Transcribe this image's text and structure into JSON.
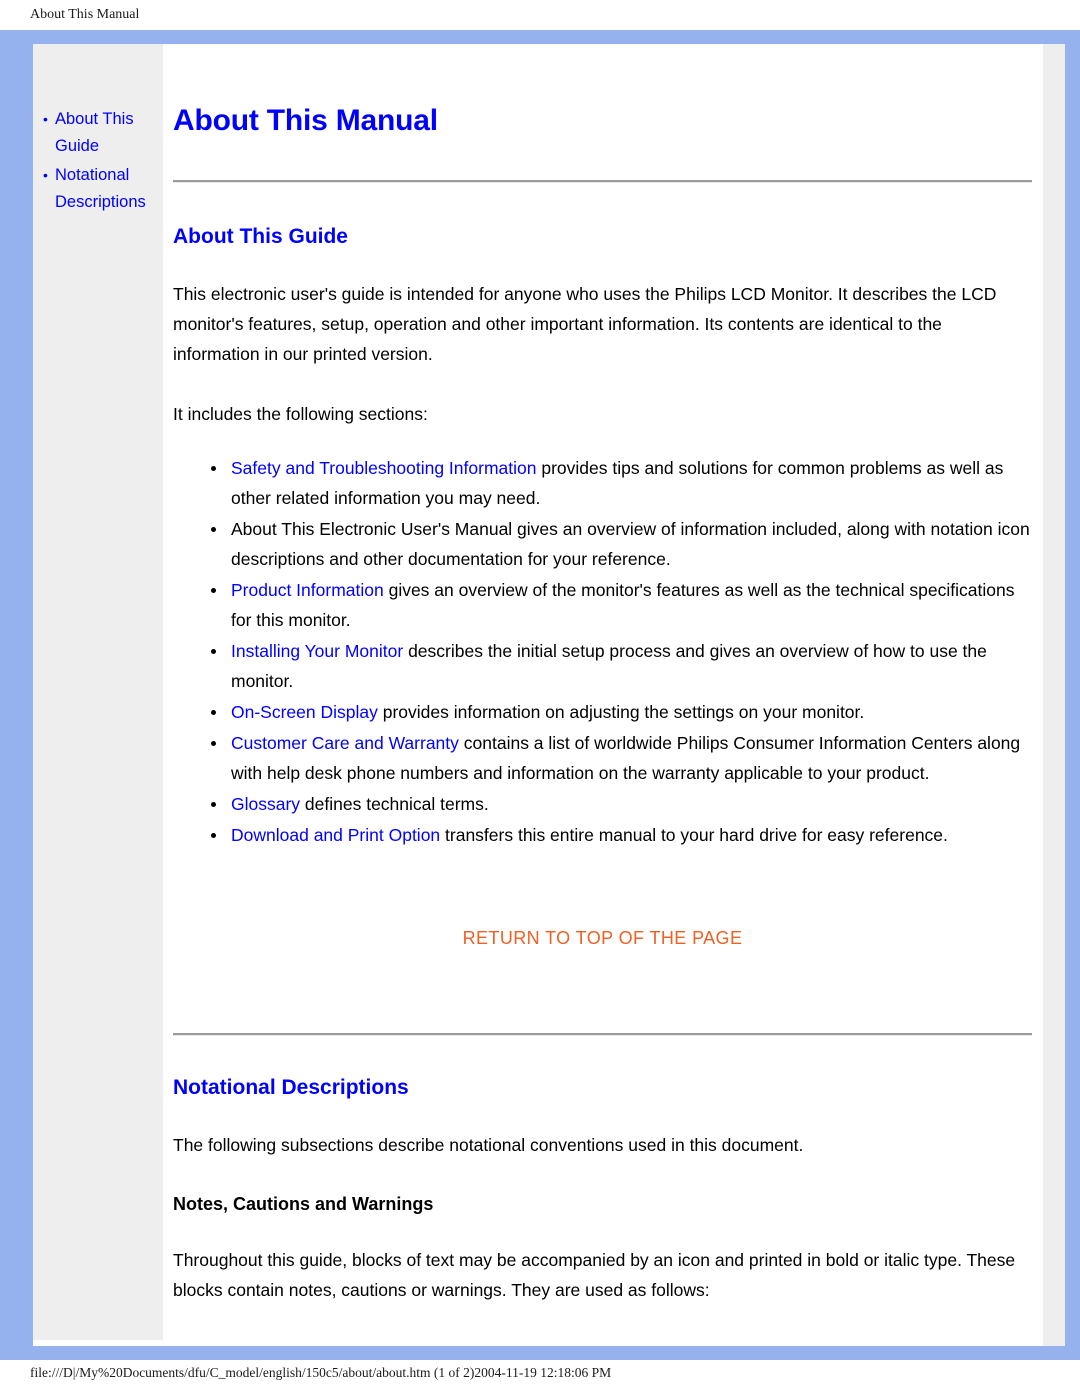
{
  "print_header": {
    "title": "About This Manual"
  },
  "sidebar": {
    "items": [
      {
        "label": "About This Guide"
      },
      {
        "label": "Notational Descriptions"
      }
    ]
  },
  "content": {
    "page_title": "About This Manual",
    "guide_section": {
      "heading": "About This Guide",
      "intro_paragraph": "This electronic user's guide is intended for anyone who uses the Philips LCD Monitor. It describes the LCD monitor's features, setup, operation and other important information. Its contents are identical to the information in our printed version.",
      "includes_line": "It includes the following sections:",
      "bullets": [
        {
          "link": "Safety and Troubleshooting Information",
          "text": " provides tips and solutions for common problems as well as other related information you may need."
        },
        {
          "link": "",
          "text": "About This Electronic User's Manual gives an overview of information included, along with notation icon descriptions and other documentation for your reference."
        },
        {
          "link": "Product Information",
          "text": " gives an overview of the monitor's features as well as the technical specifications for this monitor."
        },
        {
          "link": "Installing Your Monitor",
          "text": " describes the initial setup process and gives an overview of how to use the monitor."
        },
        {
          "link": "On-Screen Display",
          "text": " provides information on adjusting the settings on your monitor."
        },
        {
          "link": "Customer Care and Warranty",
          "text": " contains a list of worldwide Philips Consumer Information Centers along with help desk phone numbers and information on the warranty applicable to your product."
        },
        {
          "link": "Glossary",
          "text": " defines technical terms."
        },
        {
          "link": "Download and Print Option",
          "text": " transfers this entire manual to your hard drive for easy reference."
        }
      ],
      "return_to_top": "RETURN TO TOP OF THE PAGE"
    },
    "notational_section": {
      "heading": "Notational Descriptions",
      "intro_paragraph": "The following subsections describe notational conventions used in this document.",
      "sub_heading": "Notes, Cautions and Warnings",
      "body_paragraph": "Throughout this guide, blocks of text may be accompanied by an icon and printed in bold or italic type. These blocks contain notes, cautions or warnings. They are used as follows:"
    }
  },
  "footer": {
    "text": "file:///D|/My%20Documents/dfu/C_model/english/150c5/about/about.htm (1 of 2)2004-11-19 12:18:06 PM"
  },
  "colors": {
    "frame_blue": "#95b2ee",
    "link_blue": "#0000ff",
    "accent_orange": "#ef6024",
    "sidebar_gray": "#eeeeee"
  }
}
